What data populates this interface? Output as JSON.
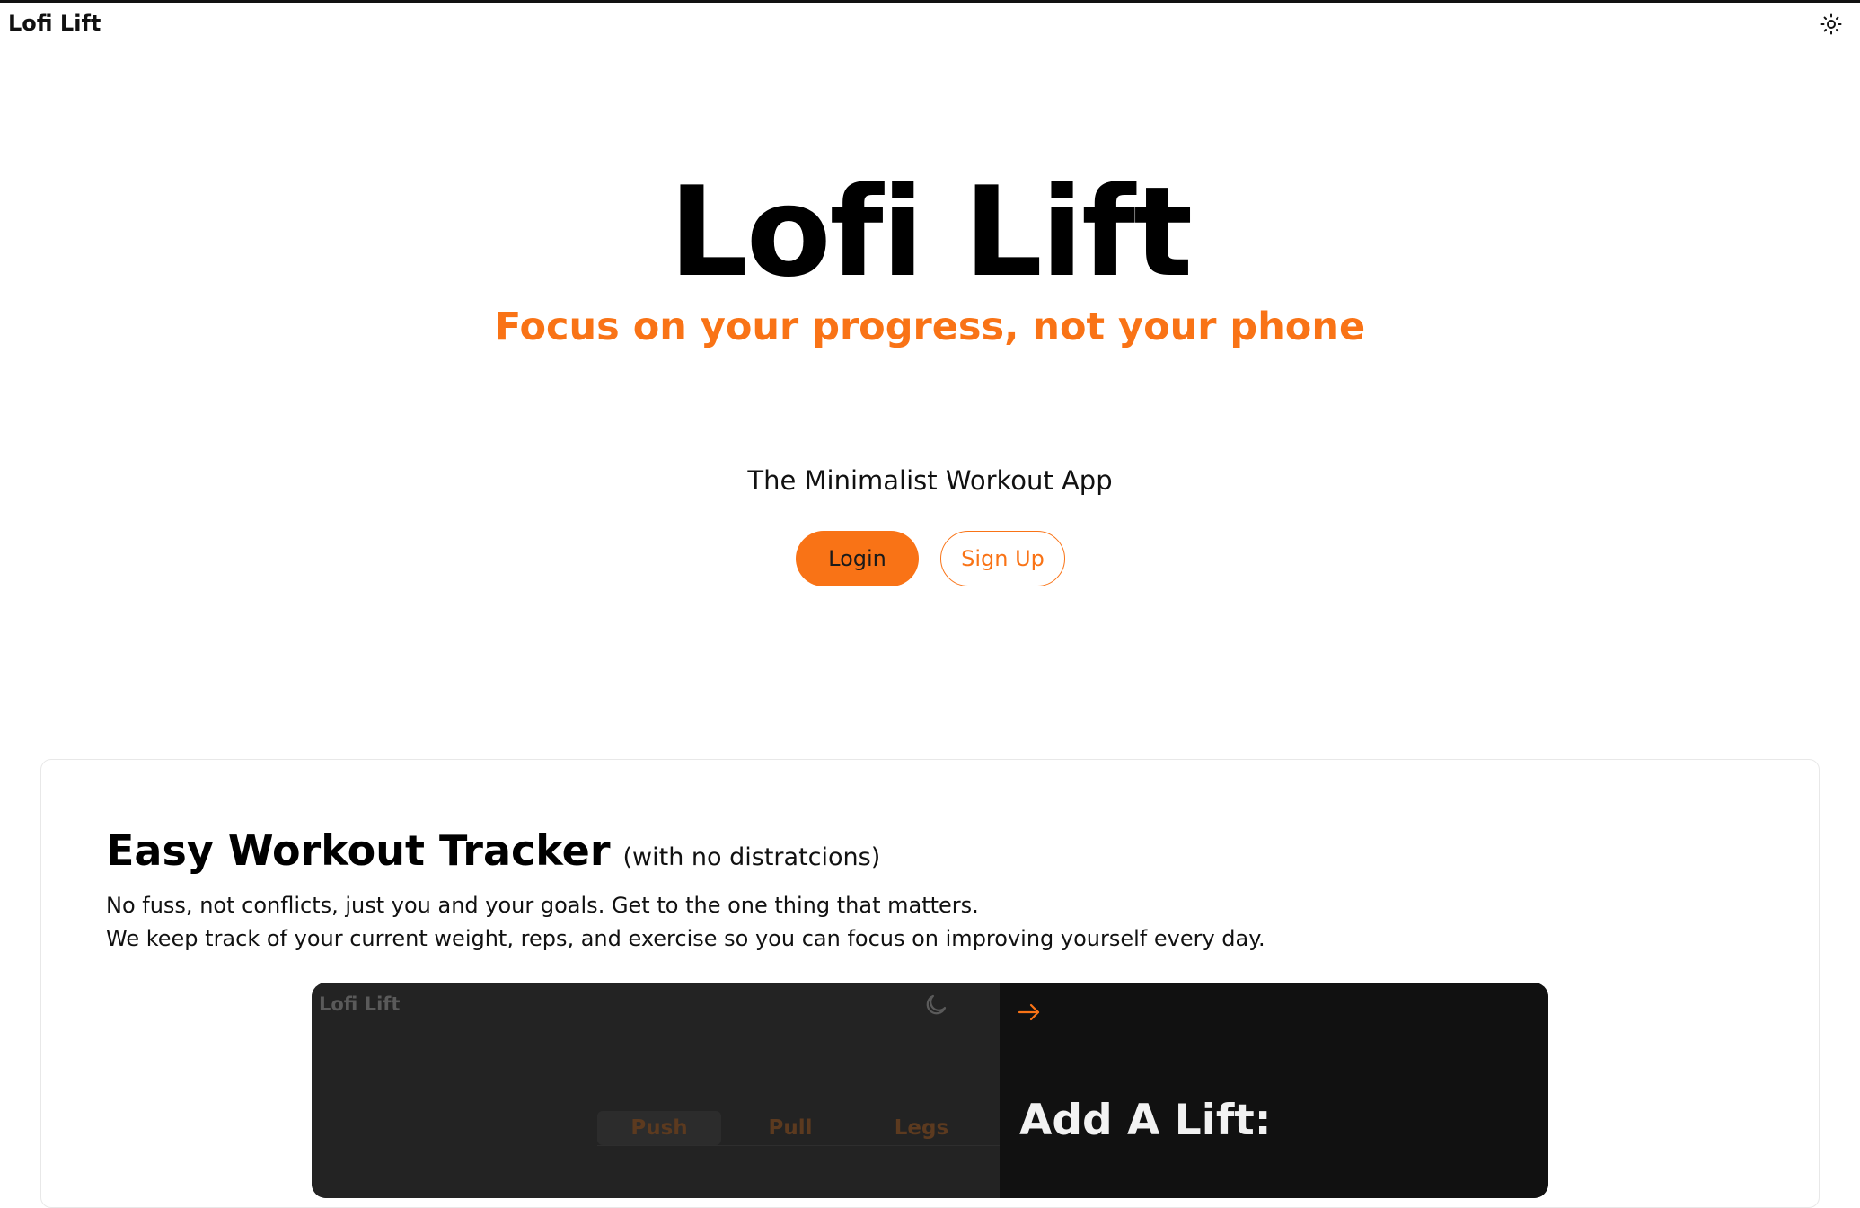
{
  "app": {
    "name": "Lofi Lift",
    "theme_icon": "sun-icon"
  },
  "hero": {
    "title": "Lofi Lift",
    "subtitle": "Focus on your progress, not your phone",
    "tagline": "The Minimalist Workout App",
    "login_label": "Login",
    "signup_label": "Sign Up"
  },
  "feature": {
    "title": "Easy Workout Tracker",
    "note": "(with no distratcions)",
    "lines": [
      "No fuss, not conflicts, just you and your goals. Get to the one thing that matters.",
      "We keep track of your current weight, reps, and exercise so you can focus on improving yourself every day."
    ]
  },
  "preview": {
    "brand": "Lofi Lift",
    "moon_icon": "moon-icon",
    "tabs": [
      "Push",
      "Pull",
      "Legs"
    ],
    "arrow_icon": "arrow-right-icon",
    "heading": "Add A Lift:"
  },
  "colors": {
    "accent": "#f97316",
    "text": "#111111",
    "preview_bg": "#232323",
    "preview_panel": "#111111"
  }
}
